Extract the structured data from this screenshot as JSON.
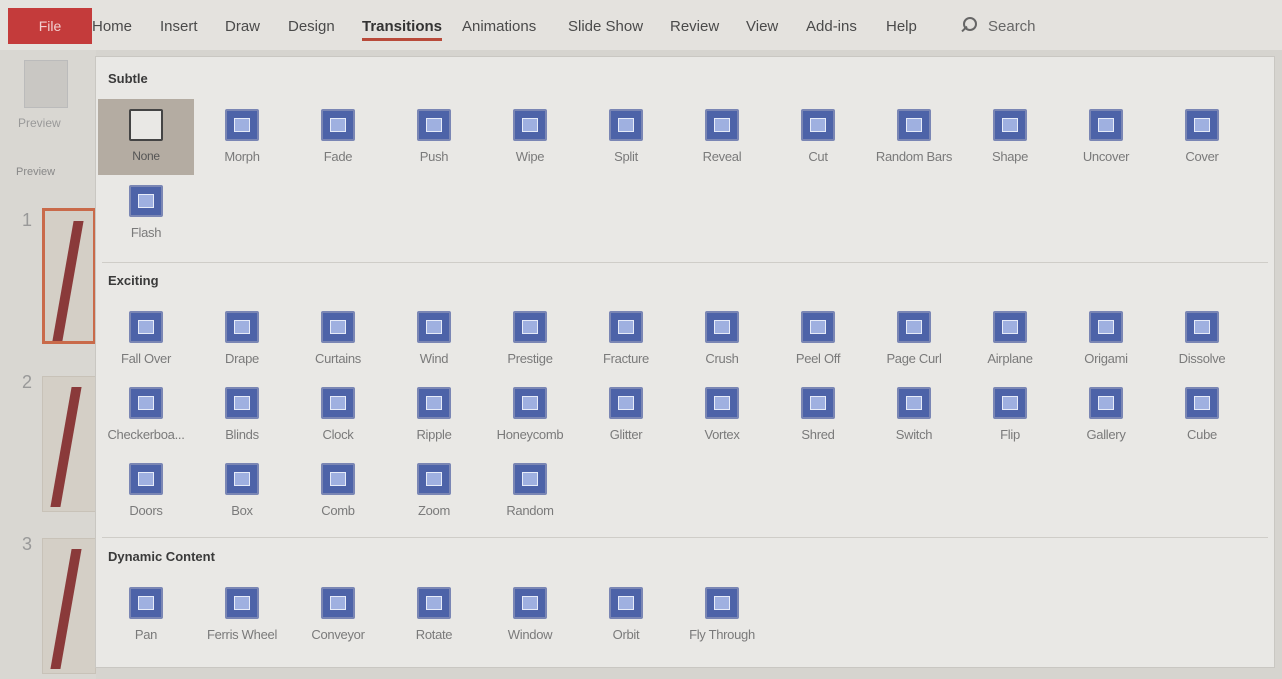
{
  "ribbon": {
    "file_tab": "File",
    "tabs": [
      "Home",
      "Insert",
      "Draw",
      "Design",
      "Transitions",
      "Animations",
      "Slide Show",
      "Review",
      "View",
      "Add-ins",
      "Help"
    ],
    "active_tab": "Transitions",
    "search_label": "Search"
  },
  "left_pane": {
    "preview_label": "Preview",
    "group_label": "Preview",
    "slides": [
      "1",
      "2",
      "3"
    ]
  },
  "gallery": {
    "sections": [
      {
        "title": "Subtle",
        "items": [
          "None",
          "Morph",
          "Fade",
          "Push",
          "Wipe",
          "Split",
          "Reveal",
          "Cut",
          "Random Bars",
          "Shape",
          "Uncover",
          "Cover",
          "Flash"
        ],
        "selected": "None"
      },
      {
        "title": "Exciting",
        "items": [
          "Fall Over",
          "Drape",
          "Curtains",
          "Wind",
          "Prestige",
          "Fracture",
          "Crush",
          "Peel Off",
          "Page Curl",
          "Airplane",
          "Origami",
          "Dissolve",
          "Checkerboa...",
          "Blinds",
          "Clock",
          "Ripple",
          "Honeycomb",
          "Glitter",
          "Vortex",
          "Shred",
          "Switch",
          "Flip",
          "Gallery",
          "Cube",
          "Doors",
          "Box",
          "Comb",
          "Zoom",
          "Random"
        ]
      },
      {
        "title": "Dynamic Content",
        "items": [
          "Pan",
          "Ferris Wheel",
          "Conveyor",
          "Rotate",
          "Window",
          "Orbit",
          "Fly Through"
        ]
      }
    ]
  }
}
